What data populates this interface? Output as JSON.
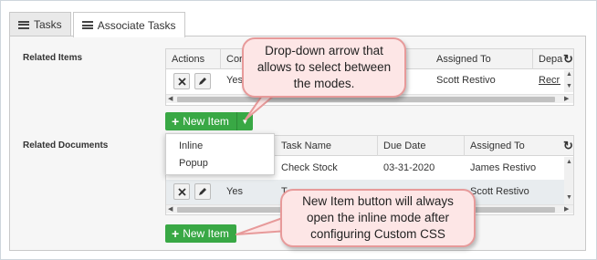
{
  "tabs": [
    {
      "label": "Tasks",
      "icon": "menu-icon"
    },
    {
      "label": "Associate Tasks",
      "icon": "menu-icon",
      "active": true
    }
  ],
  "related_items": {
    "label": "Related Items",
    "columns": [
      "Actions",
      "Cor",
      "Assigned To",
      "Depa"
    ],
    "row": {
      "completed": "Yes",
      "assigned_to": "Scott Restivo",
      "department": "Recru"
    },
    "new_item_label": "New Item",
    "dropdown_options": [
      "Inline",
      "Popup"
    ]
  },
  "related_documents": {
    "label": "Related Documents",
    "columns": [
      "Task Name",
      "Due Date",
      "Assigned To"
    ],
    "rows": [
      {
        "task_name": "Check Stock",
        "due_date": "03-31-2020",
        "assigned_to": "James Restivo"
      },
      {
        "completed": "Yes",
        "task_name": "T",
        "assigned_to": "Scott Restivo"
      }
    ],
    "new_item_label": "New Item"
  },
  "callouts": {
    "top": "Drop-down arrow that allows to select between the modes.",
    "bottom": "New Item button will always open the inline mode after configuring Custom CSS"
  },
  "icons": {
    "delete": "close-icon",
    "edit": "pencil-icon",
    "refresh": "refresh-icon"
  },
  "colors": {
    "primary_button": "#39a845",
    "callout_fill": "#fde6e6",
    "callout_border": "#e79a9a"
  }
}
